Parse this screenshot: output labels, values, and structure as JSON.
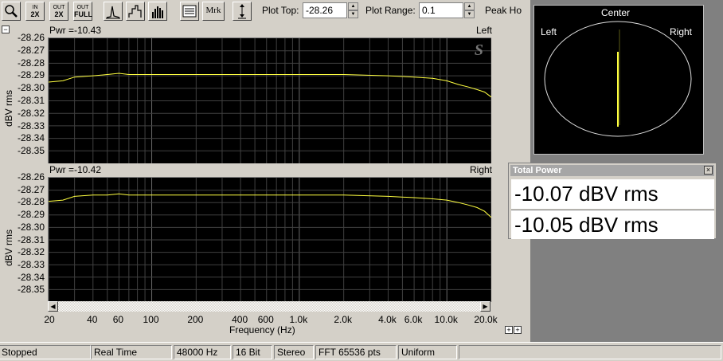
{
  "toolbar": {
    "zoom_in_top": "IN",
    "zoom_in_bottom": "2X",
    "zoom_out_top": "OUT",
    "zoom_out_bottom": "2X",
    "zoom_full_top": "OUT",
    "zoom_full_bottom": "FULL",
    "marker_label": "Mrk",
    "plot_top_label": "Plot Top:",
    "plot_top_value": "-28.26",
    "plot_range_label": "Plot Range:",
    "plot_range_value": "0.1",
    "peak_hold_label": "Peak Ho"
  },
  "plot": {
    "left": {
      "power": "Pwr =-10.43",
      "channel": "Left"
    },
    "right": {
      "power": "Pwr =-10.42",
      "channel": "Right"
    },
    "y_axis_title": "dBV rms",
    "left_y_ticks": [
      "-28.26",
      "-28.27",
      "-28.28",
      "-28.29",
      "-28.30",
      "-28.31",
      "-28.32",
      "-28.33",
      "-28.34",
      "-28.35"
    ],
    "right_y_ticks": [
      "-28.26",
      "-28.27",
      "-28.28",
      "-28.29",
      "-28.30",
      "-28.31",
      "-28.32",
      "-28.33",
      "-28.34",
      "-28.35"
    ],
    "x_ticks": [
      "20",
      "40",
      "60",
      "100",
      "200",
      "400",
      "600",
      "1.0k",
      "2.0k",
      "4.0k",
      "6.0k",
      "10.0k",
      "20.0k"
    ],
    "x_axis_title": "Frequency (Hz)",
    "watermark": "S"
  },
  "chart_data": [
    {
      "type": "line",
      "title": "Left",
      "xlabel": "Frequency (Hz)",
      "ylabel": "dBV rms",
      "x_scale": "log",
      "xlim": [
        20,
        20000
      ],
      "ylim": [
        -28.36,
        -28.26
      ],
      "grid": true,
      "series": [
        {
          "color": "#ffff40",
          "x": [
            20,
            25,
            30,
            40,
            50,
            60,
            70,
            100,
            200,
            500,
            1000,
            2000,
            4000,
            6000,
            8000,
            10000,
            12000,
            14000,
            16000,
            18000,
            20000
          ],
          "y": [
            -28.295,
            -28.294,
            -28.291,
            -28.29,
            -28.289,
            -28.288,
            -28.289,
            -28.289,
            -28.289,
            -28.289,
            -28.289,
            -28.289,
            -28.29,
            -28.291,
            -28.292,
            -28.294,
            -28.297,
            -28.299,
            -28.301,
            -28.303,
            -28.307
          ]
        }
      ]
    },
    {
      "type": "line",
      "title": "Right",
      "xlabel": "Frequency (Hz)",
      "ylabel": "dBV rms",
      "x_scale": "log",
      "xlim": [
        20,
        20000
      ],
      "ylim": [
        -28.36,
        -28.26
      ],
      "grid": true,
      "series": [
        {
          "color": "#ffff40",
          "x": [
            20,
            25,
            30,
            40,
            50,
            60,
            70,
            100,
            200,
            500,
            1000,
            2000,
            4000,
            6000,
            8000,
            10000,
            12000,
            14000,
            16000,
            18000,
            20000
          ],
          "y": [
            -28.279,
            -28.278,
            -28.275,
            -28.274,
            -28.274,
            -28.273,
            -28.274,
            -28.274,
            -28.274,
            -28.274,
            -28.274,
            -28.274,
            -28.275,
            -28.276,
            -28.277,
            -28.278,
            -28.28,
            -28.282,
            -28.284,
            -28.287,
            -28.292
          ]
        }
      ]
    }
  ],
  "phase": {
    "center": "Center",
    "left": "Left",
    "right": "Right"
  },
  "total_power": {
    "title": "Total Power",
    "left_value": "-10.07 dBV rms",
    "right_value": "-10.05 dBV rms",
    "close": "×"
  },
  "status": {
    "state": "Stopped",
    "mode": "Real Time",
    "rate": "48000 Hz",
    "bits": "16 Bit",
    "channels": "Stereo",
    "fft": "FFT 65536 pts",
    "window": "Uniform"
  },
  "colors": {
    "trace": "#ffff40",
    "plot_bg": "#000000",
    "grid": "#404040",
    "phase_bg": "#808080"
  }
}
